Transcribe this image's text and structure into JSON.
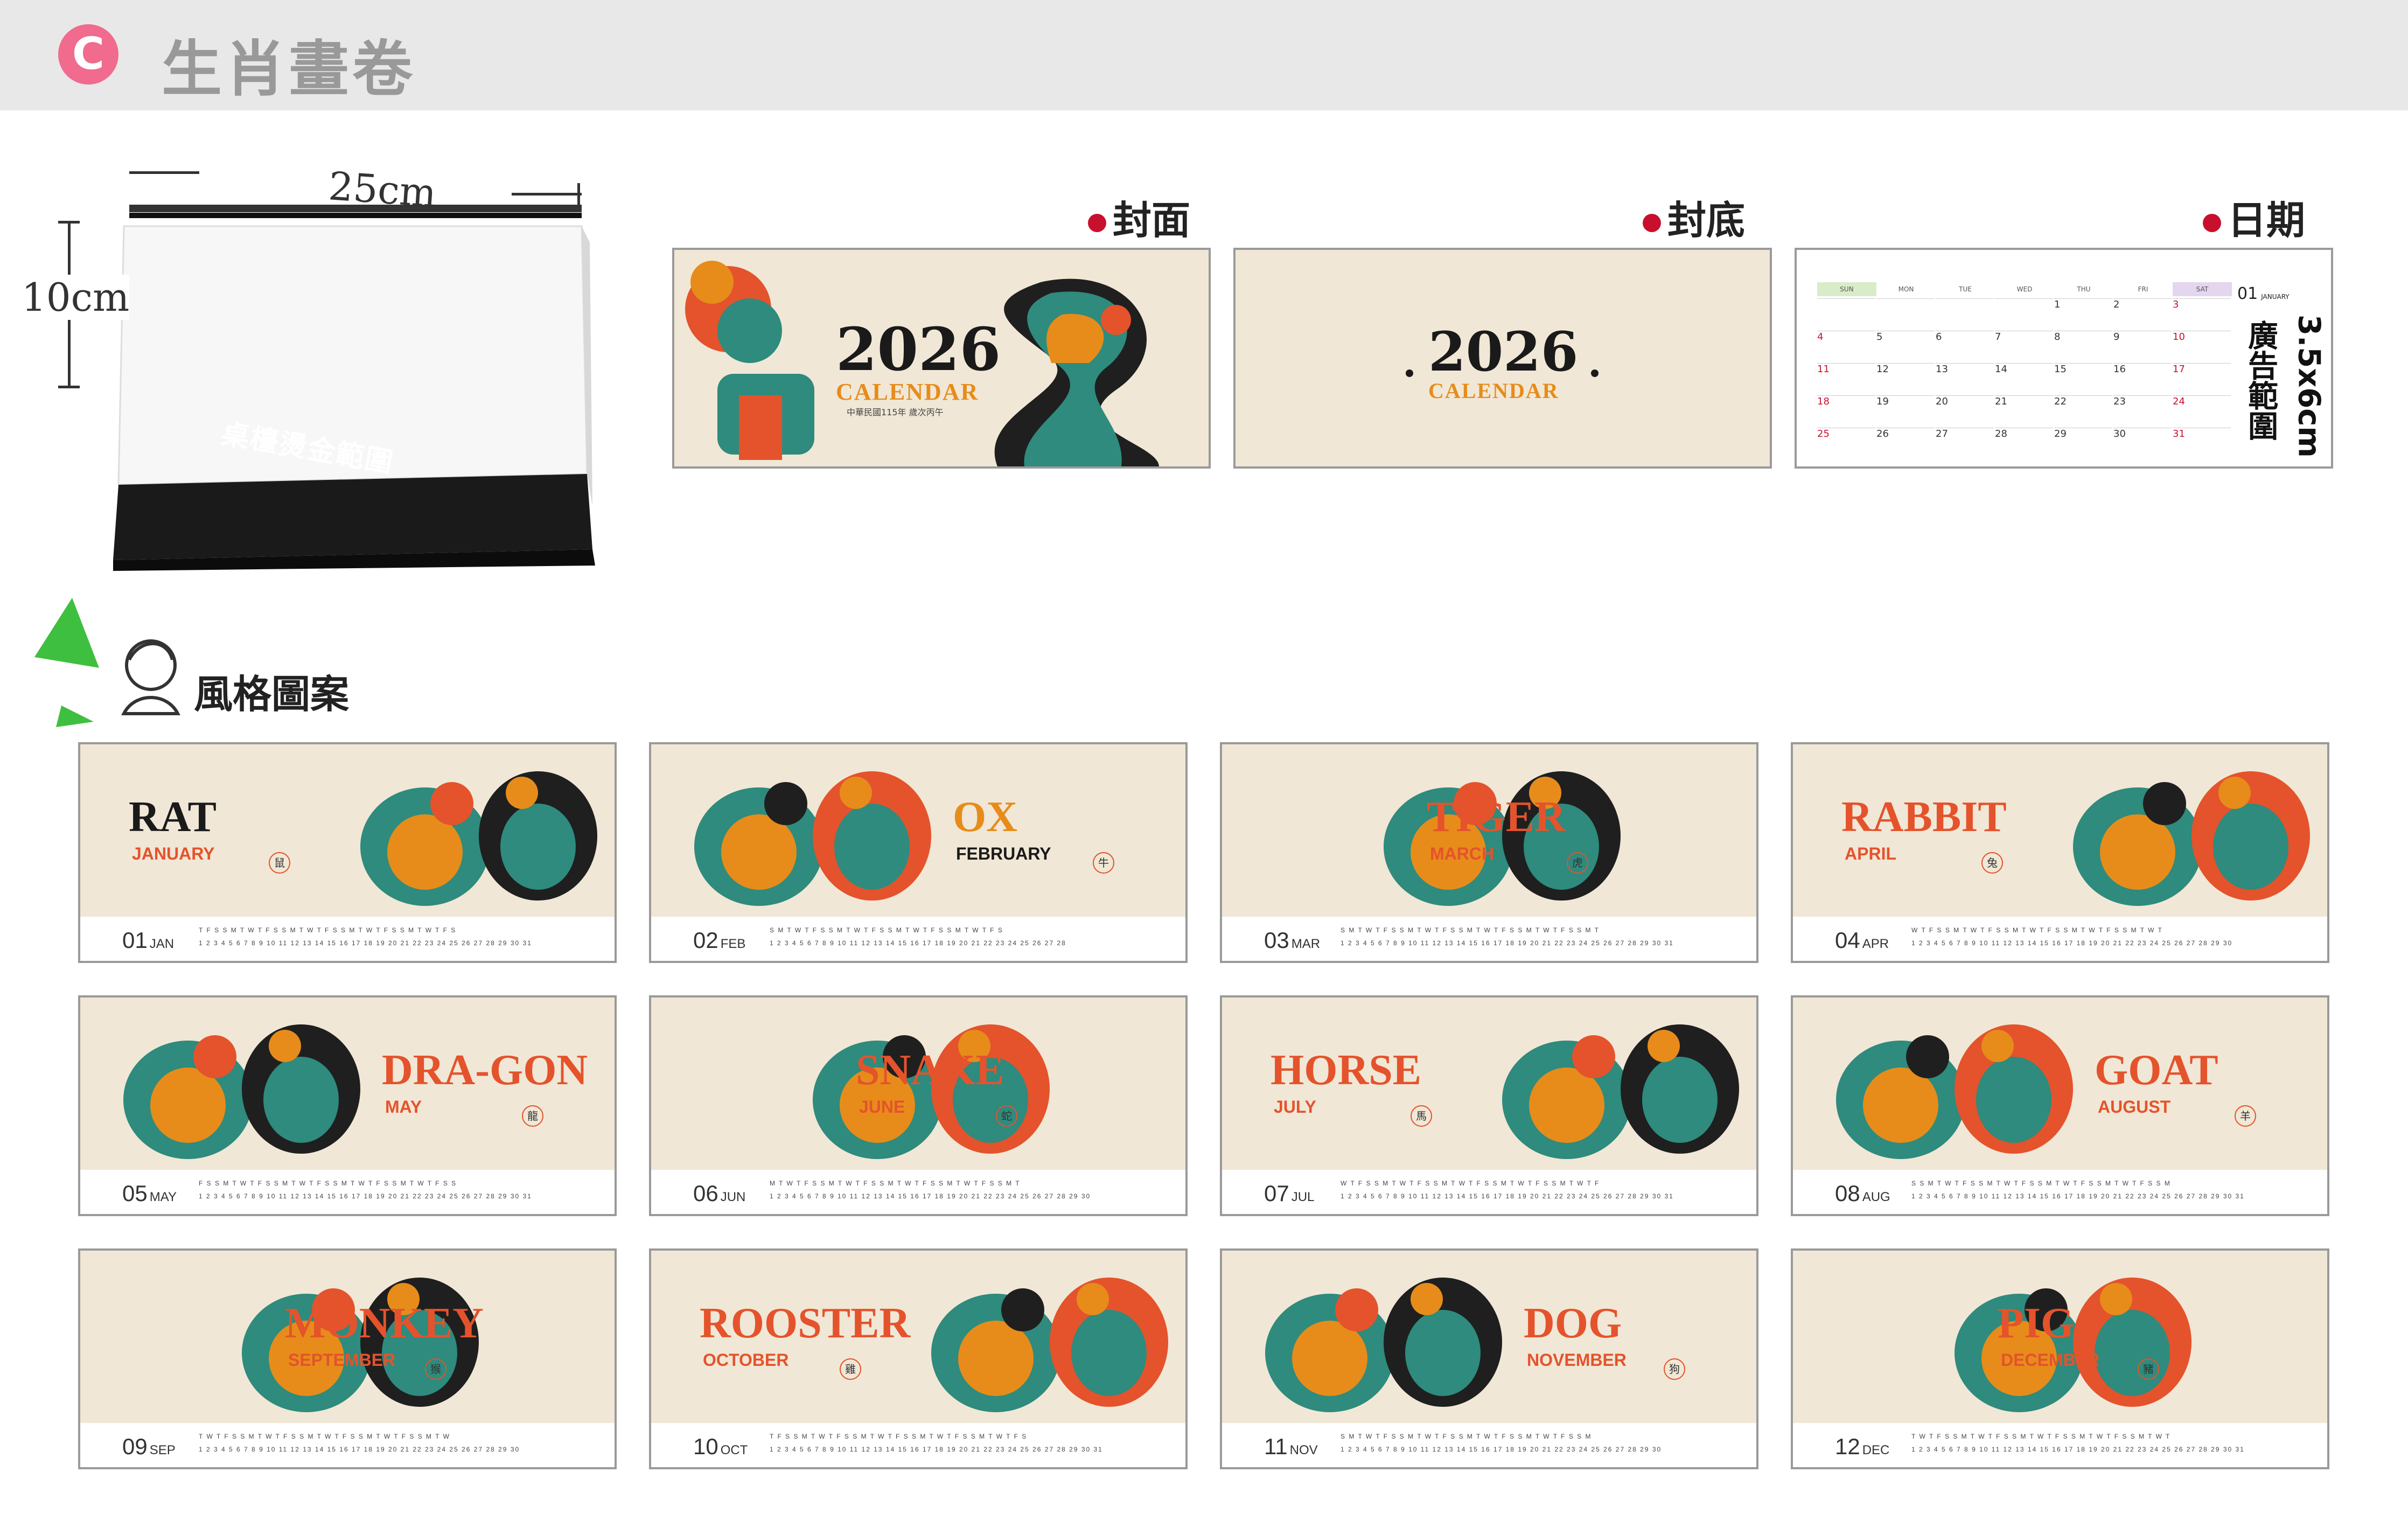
{
  "header": {
    "badge": "C",
    "title": "生肖畫卷"
  },
  "desk": {
    "width_label": "25cm",
    "height_label": "10cm",
    "base_label": "桌檯燙金範圍"
  },
  "sections": {
    "front": "封面",
    "back": "封底",
    "date": "日期"
  },
  "front_cover": {
    "year": "2026",
    "subtitle": "CALENDAR",
    "tagline": "中華民國115年 歲次丙午"
  },
  "back_cover": {
    "year": "2026",
    "subtitle": "CALENDAR"
  },
  "date_page": {
    "weekdays": [
      "SUN",
      "MON",
      "TUE",
      "WED",
      "THU",
      "FRI",
      "SAT"
    ],
    "month_label": "01",
    "month_caption": "JANUARY",
    "ad_label": "廣告範圍",
    "ad_size": "3.5x6cm",
    "rows": [
      [
        "",
        "",
        "",
        "",
        "1",
        "2",
        "3"
      ],
      [
        "4",
        "5",
        "6",
        "7",
        "8",
        "9",
        "10"
      ],
      [
        "11",
        "12",
        "13",
        "14",
        "15",
        "16",
        "17"
      ],
      [
        "18",
        "19",
        "20",
        "21",
        "22",
        "23",
        "24"
      ],
      [
        "25",
        "26",
        "27",
        "28",
        "29",
        "30",
        "31"
      ]
    ]
  },
  "style_label": "風格圖案",
  "months": [
    {
      "num": "01",
      "abbr": "JAN",
      "animal": "RAT",
      "name": "JANUARY",
      "zh": "鼠",
      "weekdays": "T F S S M T W T F S S M T W T F S S M T W T F S S M T W T F S",
      "dates": "1 2 3 4 5 6 7 8 9 10 11 12 13 14 15 16 17 18 19 20 21 22 23 24 25 26 27 28 29 30 31"
    },
    {
      "num": "02",
      "abbr": "FEB",
      "animal": "OX",
      "name": "FEBRUARY",
      "zh": "牛",
      "weekdays": "S M T W T F S S M T W T F S S M T W T F S S M T W T F S",
      "dates": "1 2 3 4 5 6 7 8 9 10 11 12 13 14 15 16 17 18 19 20 21 22 23 24 25 26 27 28"
    },
    {
      "num": "03",
      "abbr": "MAR",
      "animal": "TIGER",
      "name": "MARCH",
      "zh": "虎",
      "weekdays": "S M T W T F S S M T W T F S S M T W T F S S M T W T F S S M T",
      "dates": "1 2 3 4 5 6 7 8 9 10 11 12 13 14 15 16 17 18 19 20 21 22 23 24 25 26 27 28 29 30 31"
    },
    {
      "num": "04",
      "abbr": "APR",
      "animal": "RABBIT",
      "name": "APRIL",
      "zh": "兔",
      "weekdays": "W T F S S M T W T F S S M T W T F S S M T W T F S S M T W T",
      "dates": "1 2 3 4 5 6 7 8 9 10 11 12 13 14 15 16 17 18 19 20 21 22 23 24 25 26 27 28 29 30"
    },
    {
      "num": "05",
      "abbr": "MAY",
      "animal": "DRA-GON",
      "name": "MAY",
      "zh": "龍",
      "weekdays": "F S S M T W T F S S M T W T F S S M T W T F S S M T W T F S S",
      "dates": "1 2 3 4 5 6 7 8 9 10 11 12 13 14 15 16 17 18 19 20 21 22 23 24 25 26 27 28 29 30 31"
    },
    {
      "num": "06",
      "abbr": "JUN",
      "animal": "SNAKE",
      "name": "JUNE",
      "zh": "蛇",
      "weekdays": "M T W T F S S M T W T F S S M T W T F S S M T W T F S S M T",
      "dates": "1 2 3 4 5 6 7 8 9 10 11 12 13 14 15 16 17 18 19 20 21 22 23 24 25 26 27 28 29 30"
    },
    {
      "num": "07",
      "abbr": "JUL",
      "animal": "HORSE",
      "name": "JULY",
      "zh": "馬",
      "weekdays": "W T F S S M T W T F S S M T W T F S S M T W T F S S M T W T F",
      "dates": "1 2 3 4 5 6 7 8 9 10 11 12 13 14 15 16 17 18 19 20 21 22 23 24 25 26 27 28 29 30 31"
    },
    {
      "num": "08",
      "abbr": "AUG",
      "animal": "GOAT",
      "name": "AUGUST",
      "zh": "羊",
      "weekdays": "S S M T W T F S S M T W T F S S M T W T F S S M T W T F S S M",
      "dates": "1 2 3 4 5 6 7 8 9 10 11 12 13 14 15 16 17 18 19 20 21 22 23 24 25 26 27 28 29 30 31"
    },
    {
      "num": "09",
      "abbr": "SEP",
      "animal": "MONKEY",
      "name": "SEPTEMBER",
      "zh": "猴",
      "weekdays": "T W T F S S M T W T F S S M T W T F S S M T W T F S S M T W",
      "dates": "1 2 3 4 5 6 7 8 9 10 11 12 13 14 15 16 17 18 19 20 21 22 23 24 25 26 27 28 29 30"
    },
    {
      "num": "10",
      "abbr": "OCT",
      "animal": "ROOSTER",
      "name": "OCTOBER",
      "zh": "雞",
      "weekdays": "T F S S M T W T F S S M T W T F S S M T W T F S S M T W T F S",
      "dates": "1 2 3 4 5 6 7 8 9 10 11 12 13 14 15 16 17 18 19 20 21 22 23 24 25 26 27 28 29 30 31"
    },
    {
      "num": "11",
      "abbr": "NOV",
      "animal": "DOG",
      "name": "NOVEMBER",
      "zh": "狗",
      "weekdays": "S M T W T F S S M T W T F S S M T W T F S S M T W T F S S M",
      "dates": "1 2 3 4 5 6 7 8 9 10 11 12 13 14 15 16 17 18 19 20 21 22 23 24 25 26 27 28 29 30"
    },
    {
      "num": "12",
      "abbr": "DEC",
      "animal": "PIG",
      "name": "DECEMBER",
      "zh": "豬",
      "weekdays": "T W T F S S M T W T F S S M T W T F S S M T W T F S S M T W T",
      "dates": "1 2 3 4 5 6 7 8 9 10 11 12 13 14 15 16 17 18 19 20 21 22 23 24 25 26 27 28 29 30 31"
    }
  ]
}
